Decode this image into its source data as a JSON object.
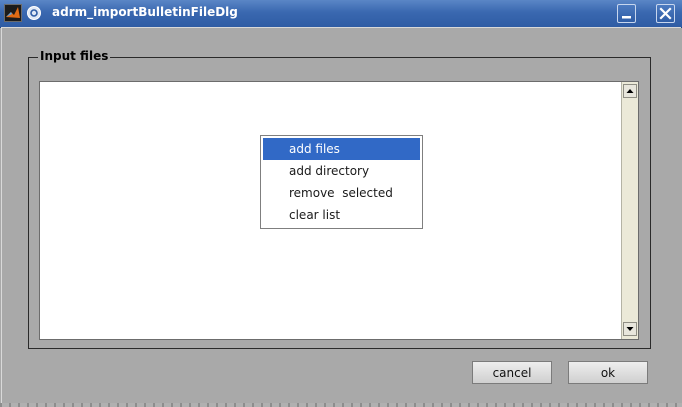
{
  "window": {
    "title": "adrm_importBulletinFileDlg",
    "icons": {
      "app": "matlab-logo-icon",
      "menu": "window-menu-icon",
      "minimize": "minimize-icon",
      "close": "close-icon"
    }
  },
  "group": {
    "label": "Input files"
  },
  "listbox": {
    "items": []
  },
  "context_menu": {
    "items": [
      {
        "label": "add files",
        "selected": true
      },
      {
        "label": "add directory",
        "selected": false
      },
      {
        "label": "remove  selected",
        "selected": false
      },
      {
        "label": "clear list",
        "selected": false
      }
    ]
  },
  "buttons": {
    "cancel": "cancel",
    "ok": "ok"
  },
  "colors": {
    "titlebar": "#3a68b0",
    "selection": "#3169c6",
    "background": "#a9a9a9"
  }
}
